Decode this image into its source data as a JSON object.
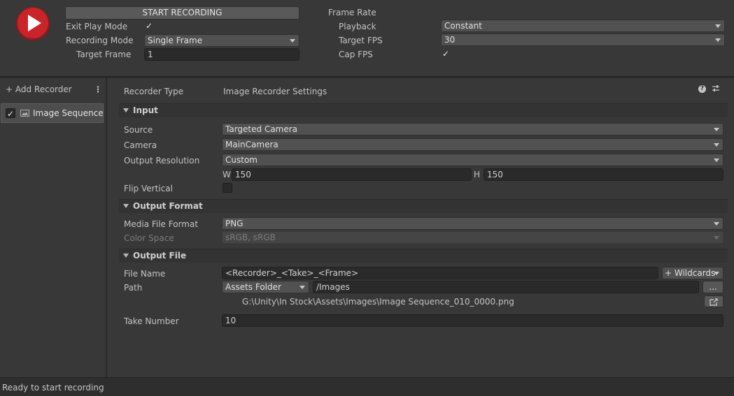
{
  "header": {
    "start_button": "START RECORDING",
    "exit_play_mode": {
      "label": "Exit Play Mode",
      "checked": true
    },
    "recording_mode": {
      "label": "Recording Mode",
      "value": "Single Frame"
    },
    "target_frame": {
      "label": "Target Frame",
      "value": "1"
    },
    "frame_rate": {
      "title": "Frame Rate",
      "playback": {
        "label": "Playback",
        "value": "Constant"
      },
      "target_fps": {
        "label": "Target FPS",
        "value": "30"
      },
      "cap_fps": {
        "label": "Cap FPS",
        "checked": true
      }
    }
  },
  "sidebar": {
    "add_recorder": "+ Add Recorder",
    "items": [
      {
        "label": "Image Sequence",
        "enabled": true
      }
    ]
  },
  "main": {
    "recorder_type": {
      "label": "Recorder Type",
      "value": "Image Recorder Settings"
    },
    "input": {
      "title": "Input",
      "source": {
        "label": "Source",
        "value": "Targeted Camera"
      },
      "camera": {
        "label": "Camera",
        "value": "MainCamera"
      },
      "output_resolution": {
        "label": "Output Resolution",
        "value": "Custom"
      },
      "width": {
        "label": "W",
        "value": "150"
      },
      "height": {
        "label": "H",
        "value": "150"
      },
      "flip_vertical": {
        "label": "Flip Vertical",
        "checked": false
      }
    },
    "output_format": {
      "title": "Output Format",
      "media_file_format": {
        "label": "Media File Format",
        "value": "PNG"
      },
      "color_space": {
        "label": "Color Space",
        "value": "sRGB, sRGB"
      }
    },
    "output_file": {
      "title": "Output File",
      "file_name": {
        "label": "File Name",
        "value": "<Recorder>_<Take>_<Frame>"
      },
      "wildcards": "+ Wildcards",
      "path": {
        "label": "Path",
        "root": "Assets Folder",
        "value": "/Images",
        "browse": "..."
      },
      "full_path": "G:\\Unity\\In Stock\\Assets\\Images\\Image Sequence_010_0000.png",
      "take_number": {
        "label": "Take Number",
        "value": "10"
      }
    }
  },
  "status": "Ready to start recording",
  "colors": {
    "record_button": "#c8242a",
    "selected_item": "#4d4d4d",
    "panel": "#383838"
  }
}
